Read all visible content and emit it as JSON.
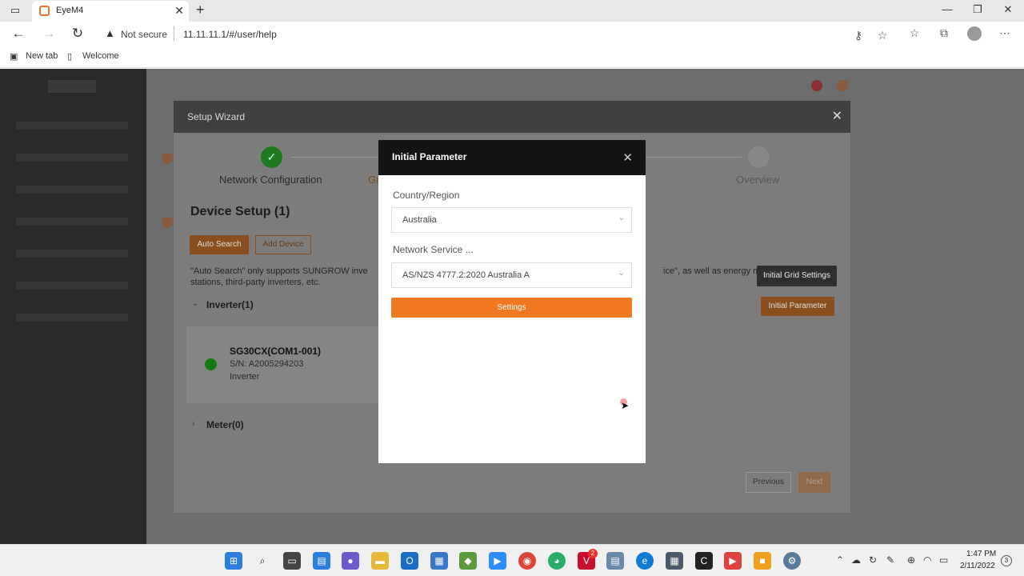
{
  "browser": {
    "tab_title": "EyeM4",
    "security_label": "Not secure",
    "url": "11.11.11.1/#/user/help",
    "favorites": [
      "New tab",
      "Welcome"
    ]
  },
  "wizard": {
    "title": "Setup Wizard",
    "steps": [
      {
        "label": "Network Configuration",
        "status": "done"
      },
      {
        "label": "Gr",
        "status": "active"
      },
      {
        "label": "Overview",
        "status": "pending"
      }
    ],
    "section_title": "Device Setup  (1)",
    "auto_search_label": "Auto Search",
    "add_device_label": "Add Device",
    "hint_line1": "\"Auto Search\" only supports SUNGROW inve",
    "hint_line1_end": "ice\", as well as energy met",
    "hint_line2": "stations, third-party inverters, etc.",
    "inverter_group": "Inverter(1)",
    "meter_group": "Meter(0)",
    "device": {
      "name": "SG30CX(COM1-001)",
      "sn": "S/N: A2005294203",
      "type": "Inverter"
    },
    "initial_parameter_label": "Initial Parameter",
    "tooltip": "Initial Grid Settings",
    "previous_label": "Previous",
    "next_label": "Next"
  },
  "modal": {
    "title": "Initial Parameter",
    "country_label": "Country/Region",
    "country_value": "Australia",
    "network_label": "Network Service ...",
    "network_value": "AS/NZS 4777.2:2020 Australia A",
    "settings_label": "Settings"
  },
  "taskbar": {
    "time": "1:47 PM",
    "date": "2/11/2022",
    "notification_count": "3",
    "badge_count": "2"
  },
  "colors": {
    "accent": "#f07820",
    "success": "#2fa52f",
    "modal_header": "#141414"
  }
}
